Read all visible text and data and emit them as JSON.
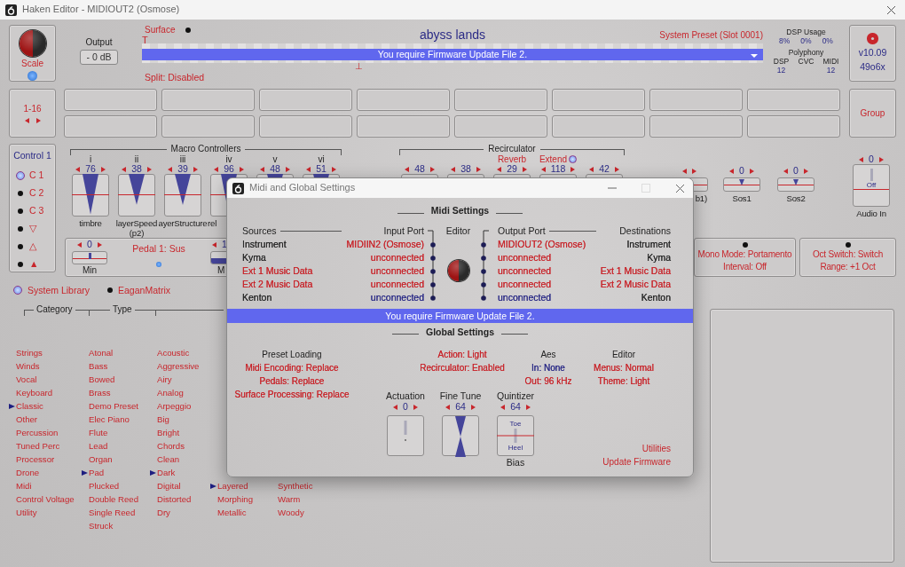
{
  "window": {
    "title": "Haken Editor - MIDIOUT2 (Osmose)"
  },
  "scale_panel": {
    "label": "Scale"
  },
  "output": {
    "label": "Output",
    "value": "- 0 dB"
  },
  "surface": {
    "label": "Surface",
    "preset_name": "abyss lands",
    "preset_slot": "System Preset (Slot 0001)",
    "top_marker": "T",
    "bottom_marker": "⊥",
    "message": "You require Firmware Update File 2.",
    "split": "Split: Disabled"
  },
  "dsp": {
    "usage_label": "DSP Usage",
    "usage": [
      "8%",
      "0%",
      "0%"
    ],
    "polyphony_label": "Polyphony",
    "poly_columns": [
      {
        "label": "DSP",
        "value": "12"
      },
      {
        "label": "CVC"
      },
      {
        "label": "MIDI",
        "value": "12"
      }
    ]
  },
  "version": {
    "version": "v10.09",
    "build": "49o6x"
  },
  "channels": {
    "label": "1-16"
  },
  "group_button": "Group",
  "controls": {
    "title": "Control 1",
    "items": [
      {
        "label": "C 1",
        "selected": true
      },
      {
        "label": "C 2",
        "selected": false
      },
      {
        "label": "C 3",
        "selected": false
      },
      {
        "label": "▽",
        "selected": false
      },
      {
        "label": "△",
        "selected": false
      },
      {
        "label": "▲",
        "selected": false
      }
    ]
  },
  "macro": {
    "title": "Macro Controllers",
    "sliders": [
      {
        "name": "i",
        "value": "76",
        "label": "timbre"
      },
      {
        "name": "ii",
        "value": "38",
        "label": "layerSpeed (p2)"
      },
      {
        "name": "iii",
        "value": "39",
        "label": "ayerStructure"
      },
      {
        "name": "iv",
        "value": "96",
        "label": "rel"
      },
      {
        "name": "v",
        "value": "48"
      },
      {
        "name": "vi",
        "value": "51"
      }
    ]
  },
  "recirculator": {
    "title": "Recirculator",
    "sliders": [
      {
        "value": "48"
      },
      {
        "value": "38"
      },
      {
        "name": "Reverb",
        "value": "29"
      },
      {
        "name": "Extend",
        "selected": true,
        "value": "118"
      },
      {
        "value": "42"
      }
    ]
  },
  "extra_sliders": [
    {
      "kind": "hslider",
      "label": "b1)",
      "level": 0.5
    },
    {
      "kind": "hslider",
      "value": "0",
      "label": "Sos1",
      "level": 0.5
    },
    {
      "kind": "hslider",
      "value": "0",
      "label": "Sos2",
      "level": 0.5
    },
    {
      "kind": "vslider",
      "value": "0",
      "label": "Audio In",
      "box_text": "Off"
    }
  ],
  "pedals": {
    "title": "Pedal 1: Sus",
    "sliders": [
      {
        "kind": "center",
        "value": "0",
        "label": "Min",
        "level": 0.5
      },
      {
        "kind": "fill",
        "value": "1",
        "label": "M",
        "level": 1
      }
    ]
  },
  "modes": [
    {
      "lines": [
        "Mono Mode: Portamento",
        "Interval: Off"
      ]
    },
    {
      "lines": [
        "Oct Switch: Switch",
        "Range: +1 Oct"
      ]
    }
  ],
  "library": [
    {
      "label": "System Library",
      "selected": true
    },
    {
      "label": "EaganMatrix",
      "selected": false
    }
  ],
  "browser": {
    "headers": [
      "Category",
      "Type"
    ],
    "columns": [
      [
        {
          "label": "Strings",
          "selected": false
        },
        {
          "label": "Winds",
          "selected": false
        },
        {
          "label": "Vocal",
          "selected": false
        },
        {
          "label": "Keyboard",
          "selected": false
        },
        {
          "label": "Classic",
          "selected": true
        },
        {
          "label": "Other",
          "selected": false
        },
        {
          "label": "Percussion",
          "selected": false
        },
        {
          "label": "Tuned Perc",
          "selected": false
        },
        {
          "label": "Processor",
          "selected": false
        },
        {
          "label": "Drone",
          "selected": false
        },
        {
          "label": "Midi",
          "selected": false
        },
        {
          "label": "Control Voltage",
          "selected": false
        },
        {
          "label": "Utility",
          "selected": false
        }
      ],
      [
        {
          "label": "Atonal",
          "selected": false
        },
        {
          "label": "Bass",
          "selected": false
        },
        {
          "label": "Bowed",
          "selected": false
        },
        {
          "label": "Brass",
          "selected": false
        },
        {
          "label": "Demo Preset",
          "selected": false
        },
        {
          "label": "Elec Piano",
          "selected": false
        },
        {
          "label": "Flute",
          "selected": false
        },
        {
          "label": "Lead",
          "selected": false
        },
        {
          "label": "Organ",
          "selected": false
        },
        {
          "label": "Pad",
          "selected": true
        },
        {
          "label": "Plucked",
          "selected": false
        },
        {
          "label": "Double Reed",
          "selected": false
        },
        {
          "label": "Single Reed",
          "selected": false
        },
        {
          "label": "Struck",
          "selected": false
        }
      ],
      [
        {
          "label": "Acoustic",
          "selected": false
        },
        {
          "label": "Aggressive",
          "selected": false
        },
        {
          "label": "Airy",
          "selected": false
        },
        {
          "label": "Analog",
          "selected": false
        },
        {
          "label": "Arpeggio",
          "selected": false
        },
        {
          "label": "Big",
          "selected": false
        },
        {
          "label": "Bright",
          "selected": false
        },
        {
          "label": "Chords",
          "selected": false
        },
        {
          "label": "Clean",
          "selected": false
        },
        {
          "label": "Dark",
          "selected": true
        },
        {
          "label": "Digital",
          "selected": false
        },
        {
          "label": "Distorted",
          "selected": false
        },
        {
          "label": "Dry",
          "selected": false
        }
      ],
      [
        {
          "label": "Layered",
          "selected": true
        },
        {
          "label": "Morphing",
          "selected": false
        },
        {
          "label": "Metallic",
          "selected": false
        }
      ],
      [
        {
          "label": "Synthetic",
          "selected": false
        },
        {
          "label": "Warm",
          "selected": false
        },
        {
          "label": "Woody",
          "selected": false
        }
      ]
    ]
  },
  "dialog": {
    "title": "Midi and Global Settings",
    "midi_heading": "Midi Settings",
    "headers": {
      "sources": "Sources",
      "input": "Input Port",
      "editor": "Editor",
      "output": "Output Port",
      "destinations": "Destinations"
    },
    "rows": [
      {
        "source": {
          "text": "Instrument",
          "color": "#2a2a2a"
        },
        "input": {
          "text": "MIDIIN2 (Osmose)",
          "color": "#c8262c"
        },
        "output": {
          "text": "MIDIOUT2 (Osmose)",
          "color": "#c8262c"
        },
        "destination": {
          "text": "Instrument",
          "color": "#2a2a2a"
        }
      },
      {
        "source": {
          "text": "Kyma",
          "color": "#2a2a2a"
        },
        "input": {
          "text": "unconnected",
          "color": "#c8262c"
        },
        "output": {
          "text": "unconnected",
          "color": "#c8262c"
        },
        "destination": {
          "text": "Kyma",
          "color": "#2a2a2a"
        }
      },
      {
        "source": {
          "text": "Ext 1 Music Data",
          "color": "#c8262c"
        },
        "input": {
          "text": "unconnected",
          "color": "#c8262c"
        },
        "output": {
          "text": "unconnected",
          "color": "#c8262c"
        },
        "destination": {
          "text": "Ext 1 Music Data",
          "color": "#c8262c"
        }
      },
      {
        "source": {
          "text": "Ext 2 Music Data",
          "color": "#c8262c"
        },
        "input": {
          "text": "unconnected",
          "color": "#c8262c"
        },
        "output": {
          "text": "unconnected",
          "color": "#c8262c"
        },
        "destination": {
          "text": "Ext 2 Music Data",
          "color": "#c8262c"
        }
      },
      {
        "source": {
          "text": "Kenton",
          "color": "#2a2a2a"
        },
        "input": {
          "text": "unconnected",
          "color": "#2b2b86"
        },
        "output": {
          "text": "unconnected",
          "color": "#2b2b86"
        },
        "destination": {
          "text": "Kenton",
          "color": "#2a2a2a"
        }
      }
    ],
    "message": "You require Firmware Update File 2.",
    "global_heading": "Global Settings",
    "global_columns": [
      {
        "header": "Preset Loading",
        "items": [
          {
            "text": "Midi Encoding: Replace",
            "color": "#c8262c"
          },
          {
            "text": "Pedals: Replace",
            "color": "#c8262c"
          },
          {
            "text": "Surface Processing: Replace",
            "color": "#c8262c"
          }
        ]
      },
      {
        "items": [
          {
            "text": "Action: Light",
            "color": "#c8262c"
          },
          {
            "text": "Recirculator: Enabled",
            "color": "#c8262c"
          }
        ]
      },
      {
        "header": "Aes",
        "items": [
          {
            "text": "In: None",
            "color": "#2b2b86"
          },
          {
            "text": "Out: 96 kHz",
            "color": "#c8262c"
          }
        ]
      },
      {
        "header": "Editor",
        "items": [
          {
            "text": "Menus: Normal",
            "color": "#c8262c"
          },
          {
            "text": "Theme: Light",
            "color": "#c8262c"
          }
        ]
      }
    ],
    "sliders": [
      {
        "kind": "actuation",
        "label": "Actuation",
        "value": "0"
      },
      {
        "kind": "fine_tune",
        "label": "Fine Tune",
        "value": "64"
      },
      {
        "kind": "quintizer",
        "label": "Quintizer",
        "value": "64",
        "top_text": "Toe",
        "bottom_text": "Heel",
        "caption": "Bias"
      }
    ],
    "links": [
      "Utilities",
      "Update Firmware"
    ]
  }
}
